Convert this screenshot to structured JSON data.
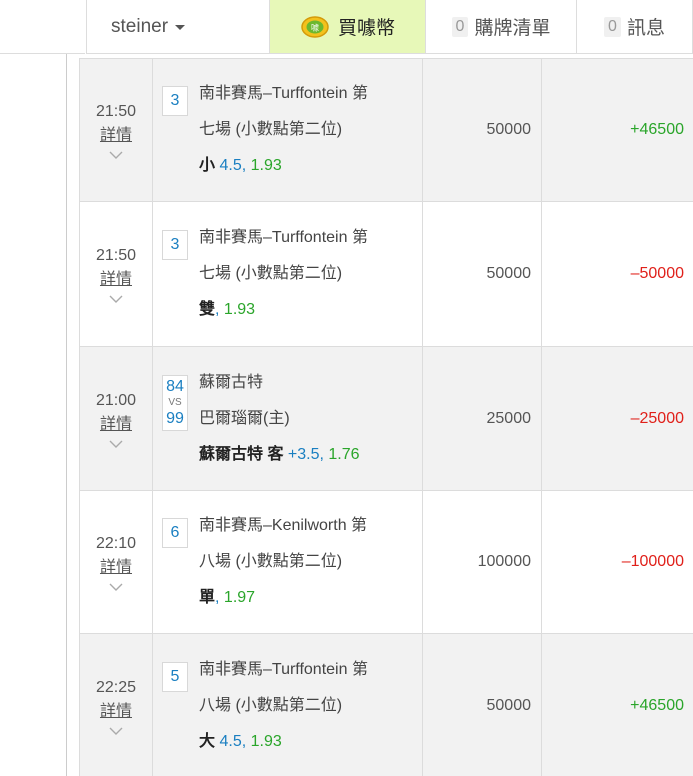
{
  "nav": {
    "user": "steiner",
    "buy_label": "買噱幣",
    "cart_count": "0",
    "cart_label": "購牌清單",
    "msg_count": "0",
    "msg_label": "訊息"
  },
  "bets": [
    {
      "time": "21:50",
      "detail": "詳情",
      "num": "3",
      "event_line1": "南非賽馬–Turffontein 第",
      "event_line2": "七場 (小數點第二位)",
      "selection": "小",
      "line": "4.5,",
      "odds": "1.93",
      "stake": "50000",
      "result": "+46500",
      "result_sign": "pos"
    },
    {
      "time": "21:50",
      "detail": "詳情",
      "num": "3",
      "event_line1": "南非賽馬–Turffontein 第",
      "event_line2": "七場 (小數點第二位)",
      "selection": "雙",
      "line": ",",
      "odds": "1.93",
      "stake": "50000",
      "result": "–50000",
      "result_sign": "neg"
    },
    {
      "time": "21:00",
      "detail": "詳情",
      "num_home": "84",
      "vs": "VS",
      "num_away": "99",
      "event_line1": "蘇爾古特",
      "event_line2": "巴爾瑙爾(主)",
      "selection": "蘇爾古特 客",
      "line": "+3.5,",
      "odds": "1.76",
      "stake": "25000",
      "result": "–25000",
      "result_sign": "neg"
    },
    {
      "time": "22:10",
      "detail": "詳情",
      "num": "6",
      "event_line1": "南非賽馬–Kenilworth 第",
      "event_line2": "八場 (小數點第二位)",
      "selection": "單",
      "line": ",",
      "odds": "1.97",
      "stake": "100000",
      "result": "–100000",
      "result_sign": "neg"
    },
    {
      "time": "22:25",
      "detail": "詳情",
      "num": "5",
      "event_line1": "南非賽馬–Turffontein 第",
      "event_line2": "八場 (小數點第二位)",
      "selection": "大",
      "line": "4.5,",
      "odds": "1.93",
      "stake": "50000",
      "result": "+46500",
      "result_sign": "pos"
    }
  ],
  "colors": {
    "positive": "#2aa52a",
    "negative": "#e0201a",
    "link_blue": "#1a7fc1",
    "buy_bg": "#e7f8b8",
    "row_shaded": "#f2f2f2"
  }
}
